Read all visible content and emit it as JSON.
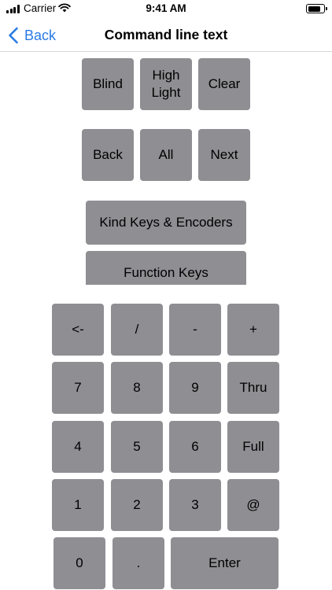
{
  "status_bar": {
    "carrier": "Carrier",
    "time": "9:41 AM",
    "battery_level": 0.8
  },
  "nav": {
    "back_label": "Back",
    "title": "Command line text"
  },
  "top_keys": {
    "row1": [
      "Blind",
      "High\nLight",
      "Clear"
    ],
    "row2": [
      "Back",
      "All",
      "Next"
    ],
    "kind_keys": "Kind Keys & Encoders",
    "function_keys": "Function Keys"
  },
  "keypad": {
    "row1": [
      "<-",
      "/",
      "-",
      "+"
    ],
    "row2": [
      "7",
      "8",
      "9",
      "Thru"
    ],
    "row3": [
      "4",
      "5",
      "6",
      "Full"
    ],
    "row4": [
      "1",
      "2",
      "3",
      "@"
    ],
    "row5": [
      "0",
      ".",
      "Enter"
    ]
  },
  "colors": {
    "key_background": "#8e8e93",
    "link": "#2a7be4"
  },
  "icons": [
    "signal-icon",
    "wifi-icon",
    "battery-icon",
    "chevron-left-icon"
  ]
}
